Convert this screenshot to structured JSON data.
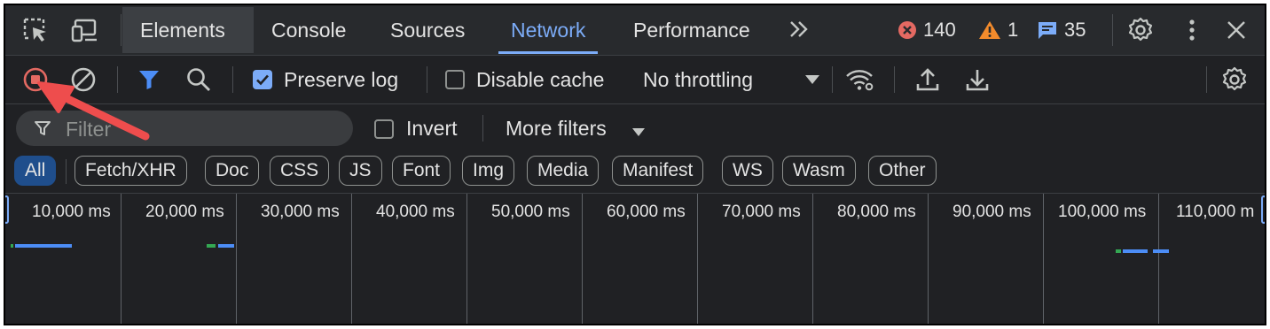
{
  "tabs": [
    {
      "label": "Elements",
      "state": "panel"
    },
    {
      "label": "Console",
      "state": "normal"
    },
    {
      "label": "Sources",
      "state": "normal"
    },
    {
      "label": "Network",
      "state": "selected"
    },
    {
      "label": "Performance",
      "state": "normal"
    }
  ],
  "more_tabs": "»",
  "counters": {
    "errors": "140",
    "warnings": "1",
    "messages": "35"
  },
  "toolbar": {
    "preserve_log": "Preserve log",
    "preserve_log_checked": true,
    "disable_cache": "Disable cache",
    "disable_cache_checked": false,
    "throttling": "No throttling"
  },
  "filter": {
    "placeholder": "Filter",
    "invert": "Invert",
    "more_filters": "More filters"
  },
  "type_filters": [
    "All",
    "Fetch/XHR",
    "Doc",
    "CSS",
    "JS",
    "Font",
    "Img",
    "Media",
    "Manifest",
    "WS",
    "Wasm",
    "Other"
  ],
  "active_type_filter": "All",
  "timeline": {
    "ticks": [
      "10,000 ms",
      "20,000 ms",
      "30,000 ms",
      "40,000 ms",
      "50,000 ms",
      "60,000 ms",
      "70,000 ms",
      "80,000 ms",
      "90,000 ms",
      "100,000 ms",
      "110,000 m"
    ]
  },
  "colors": {
    "accent": "#7cacf8",
    "record_red": "#e46962",
    "error_red": "#e46962",
    "warning_orange": "#f28b2c",
    "message_blue": "#7cacf8",
    "filter_blue": "#4c8df6",
    "waterfall_blue": "#4c8df6",
    "waterfall_green": "#34a853",
    "annotation_arrow": "#ee4d4d"
  }
}
